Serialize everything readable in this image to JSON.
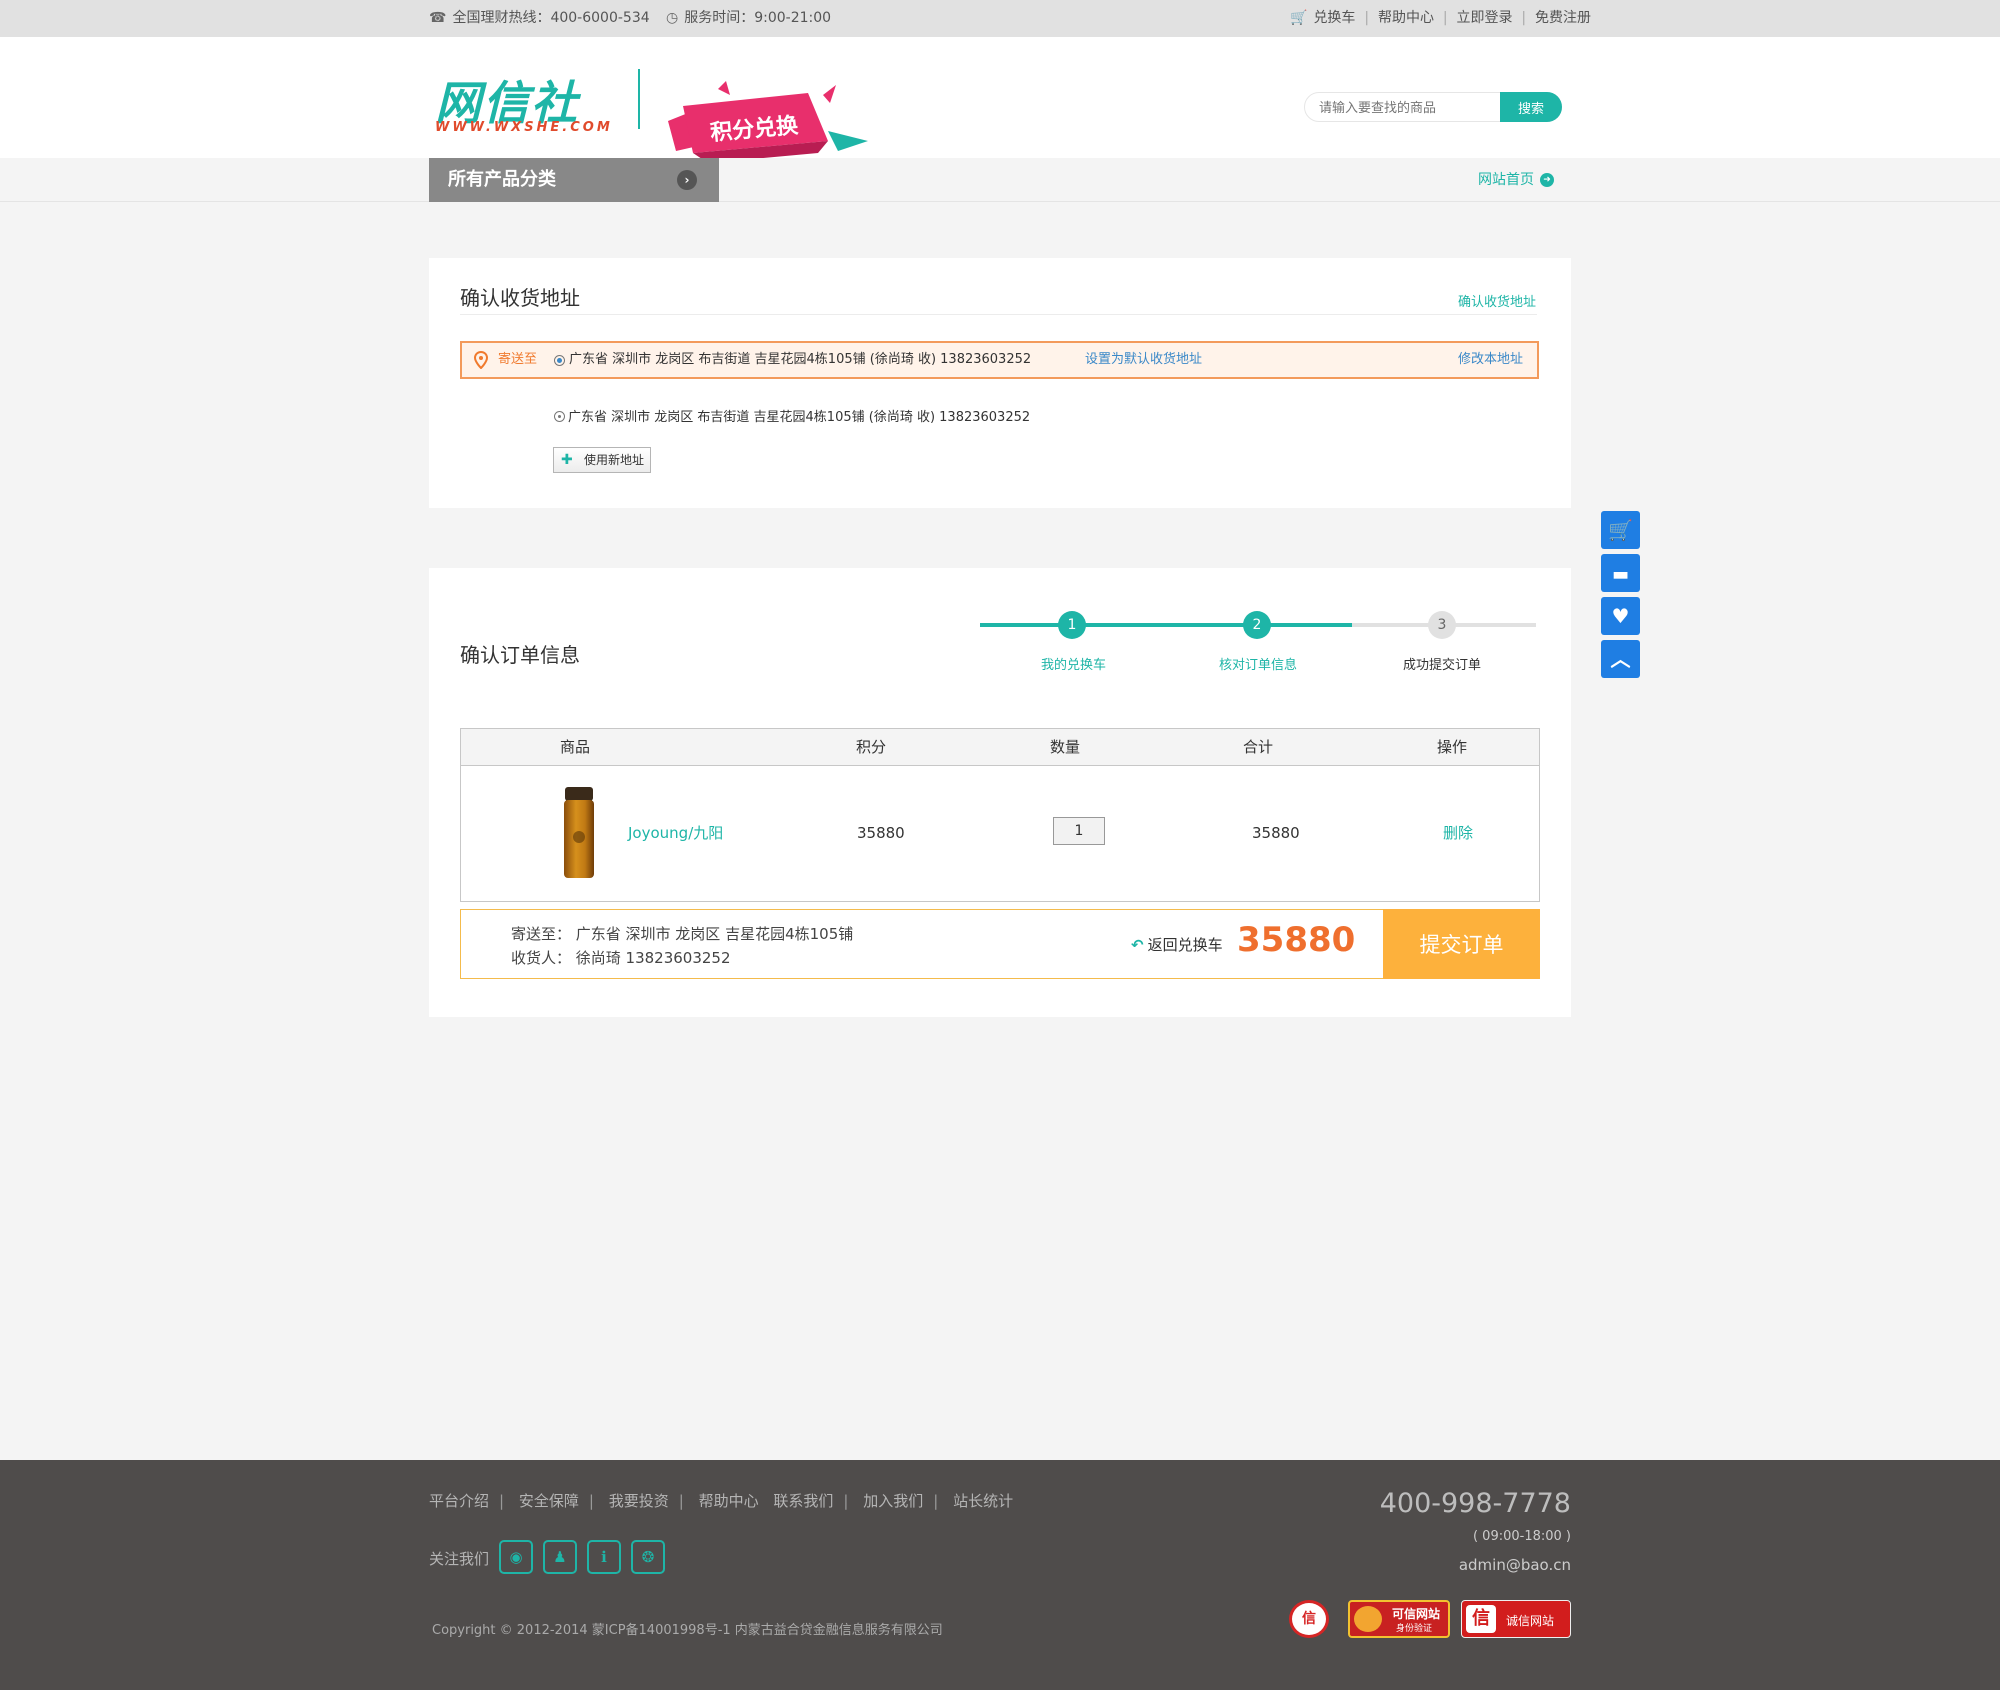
{
  "topbar": {
    "hotline": "全国理财热线：400-6000-534",
    "service_time": "服务时间：9:00-21:00",
    "links": [
      "兑换车",
      "帮助中心",
      "立即登录",
      "免费注册"
    ]
  },
  "header": {
    "logo_text": "网信社",
    "logo_url_text": "WWW.WXSHE.COM",
    "badge_text": "积分兑换",
    "search_placeholder": "请输入要查找的商品",
    "search_button": "搜索"
  },
  "nav": {
    "category_label": "所有产品分类",
    "home_link": "网站首页"
  },
  "address_section": {
    "title": "确认收货地址",
    "header_link": "确认收货地址",
    "send_to_label": "寄送至",
    "selected_address": "广东省 深圳市 龙岗区 布吉街道 吉星花园4栋105铺 (徐尚琦 收) 13823603252",
    "set_default_link": "设置为默认收货地址",
    "modify_link": "修改本地址",
    "other_address": "广东省 深圳市 龙岗区 布吉街道 吉星花园4栋105铺 (徐尚琦 收) 13823603252",
    "new_address_button": "使用新地址"
  },
  "order_section": {
    "title": "确认订单信息",
    "steps": [
      {
        "num": "1",
        "label": "我的兑换车"
      },
      {
        "num": "2",
        "label": "核对订单信息"
      },
      {
        "num": "3",
        "label": "成功提交订单"
      }
    ],
    "table_headers": [
      "商品",
      "积分",
      "数量",
      "合计",
      "操作"
    ],
    "row": {
      "product_name": "Joyoung/九阳",
      "points": "35880",
      "quantity": "1",
      "subtotal": "35880",
      "action": "删除"
    },
    "summary": {
      "send_to": "寄送至：  广东省 深圳市 龙岗区 吉星花园4栋105铺",
      "receiver": "收货人：  徐尚琦 13823603252",
      "back_link": "返回兑换车",
      "total": "35880",
      "submit_button": "提交订单"
    }
  },
  "footer": {
    "links": [
      "平台介绍",
      "安全保障",
      "我要投资",
      "帮助中心",
      "联系我们",
      "加入我们",
      "站长统计"
    ],
    "follow_label": "关注我们",
    "copyright": "Copyright © 2012-2014 蒙ICP备14001998号-1 内蒙古益合贷金融信息服务有限公司",
    "phone": "400-998-7778",
    "hours": "( 09:00-18:00 )",
    "email": "admin@bao.cn",
    "cert_badges": [
      "可信网站",
      "身份验证",
      "诚信网站"
    ]
  },
  "colors": {
    "accent": "#1eb5a7",
    "orange": "#ef6f2e",
    "submit": "#fdb13c",
    "float_blue": "#1f7ee3",
    "footer_bg": "#4f4c4b"
  }
}
